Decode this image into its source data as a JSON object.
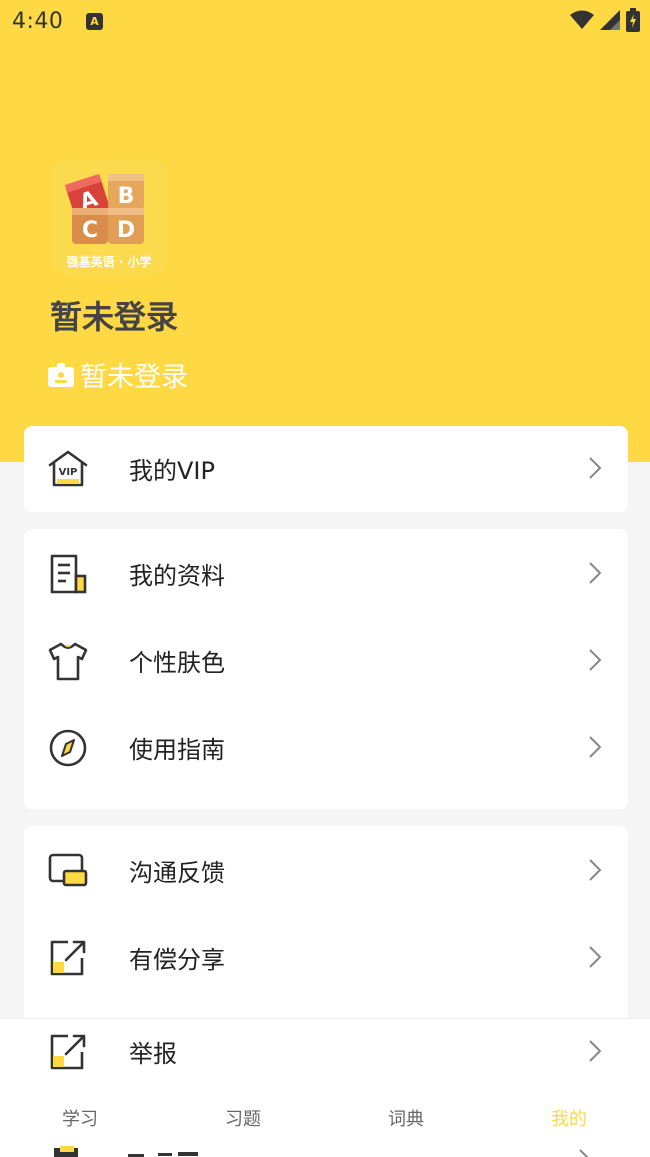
{
  "status": {
    "time": "4:40",
    "notif_badge": "A"
  },
  "profile": {
    "app_logo_caption": "强基英语 · 小学",
    "name": "暂未登录",
    "subtitle": "暂未登录"
  },
  "vip": {
    "label": "我的VIP"
  },
  "menu_group1": [
    {
      "label": "我的资料",
      "icon": "document-icon"
    },
    {
      "label": "个性肤色",
      "icon": "tshirt-icon"
    },
    {
      "label": "使用指南",
      "icon": "compass-icon"
    }
  ],
  "menu_group2": [
    {
      "label": "沟通反馈",
      "icon": "chat-icon"
    },
    {
      "label": "有偿分享",
      "icon": "share-icon"
    },
    {
      "label": "举报",
      "icon": "report-icon"
    }
  ],
  "tabs": [
    {
      "label": "学习",
      "active": false
    },
    {
      "label": "习题",
      "active": false
    },
    {
      "label": "词典",
      "active": false
    },
    {
      "label": "我的",
      "active": true
    }
  ],
  "colors": {
    "accent": "#FED944",
    "background": "#f5f5f5",
    "card": "#ffffff"
  }
}
